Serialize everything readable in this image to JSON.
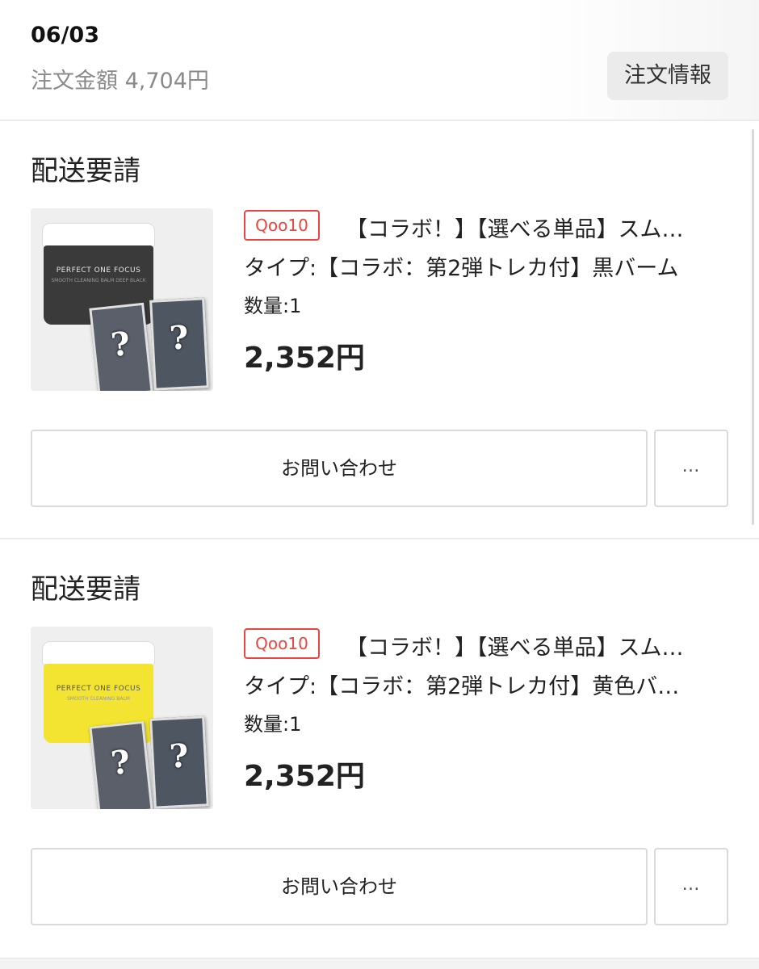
{
  "order": {
    "date": "06/03",
    "amount": "注文金額 4,704円",
    "info_button": "注文情報"
  },
  "shipments": [
    {
      "title": "配送要請",
      "image": {
        "brand": "PERFECT ONE FOCUS",
        "subtitle": "SMOOTH CLEANING BALM DEEP BLACK",
        "jar_color": "black",
        "card_marks": [
          "?",
          "?"
        ]
      },
      "shop_badge": "Qoo10",
      "product_title": "【コラボ！】【選べる単品】スム…",
      "option": "タイプ:【コラボ：第2弾トレカ付】黒バーム",
      "quantity": "数量:1",
      "price": "2,352円",
      "contact_button": "お問い合わせ",
      "more_button": "…"
    },
    {
      "title": "配送要請",
      "image": {
        "brand": "PERFECT ONE FOCUS",
        "subtitle": "SMOOTH CLEANING BALM",
        "jar_color": "yellow",
        "card_marks": [
          "?",
          "?"
        ]
      },
      "shop_badge": "Qoo10",
      "product_title": "【コラボ！】【選べる単品】スム…",
      "option": "タイプ:【コラボ：第2弾トレカ付】黄色バ…",
      "quantity": "数量:1",
      "price": "2,352円",
      "contact_button": "お問い合わせ",
      "more_button": "…"
    }
  ],
  "colors": {
    "badge_red": "#e8463f",
    "text_main": "#222222",
    "text_muted": "#8a8a8a",
    "button_bg": "#ebebeb"
  }
}
